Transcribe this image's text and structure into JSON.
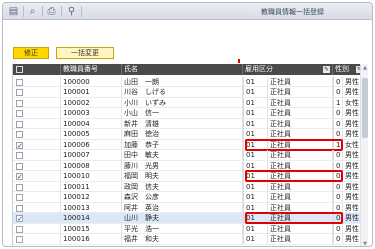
{
  "window": {
    "title": "教職員情報一括登録"
  },
  "toolbar": {
    "icons": [
      "document-list-icon",
      "magnifier-icon",
      "printer-icon",
      "person-key-icon"
    ]
  },
  "actions": {
    "edit_label": "修正",
    "bulk_change_label": "一括変更"
  },
  "table": {
    "columns": {
      "check": "",
      "staff_no": "教職員番号",
      "name": "氏名",
      "employment": "雇用区分",
      "sex": "性別"
    },
    "rows": [
      {
        "checked": false,
        "staff_no": "100000",
        "name": "山田　一朗",
        "emp_code": "01",
        "emp_name": "正社員",
        "sex_code": "0",
        "sex_name": "男性"
      },
      {
        "checked": false,
        "staff_no": "100001",
        "name": "川谷　しげる",
        "emp_code": "01",
        "emp_name": "正社員",
        "sex_code": "0",
        "sex_name": "男性"
      },
      {
        "checked": false,
        "staff_no": "100002",
        "name": "小川　いずみ",
        "emp_code": "01",
        "emp_name": "正社員",
        "sex_code": "1",
        "sex_name": "女性"
      },
      {
        "checked": false,
        "staff_no": "100003",
        "name": "小山　信一",
        "emp_code": "01",
        "emp_name": "正社員",
        "sex_code": "0",
        "sex_name": "男性"
      },
      {
        "checked": false,
        "staff_no": "100004",
        "name": "新井　清雄",
        "emp_code": "01",
        "emp_name": "正社員",
        "sex_code": "0",
        "sex_name": "男性"
      },
      {
        "checked": false,
        "staff_no": "100005",
        "name": "麻田　徳治",
        "emp_code": "01",
        "emp_name": "正社員",
        "sex_code": "0",
        "sex_name": "男性"
      },
      {
        "checked": true,
        "staff_no": "100006",
        "name": "加藤　恭子",
        "emp_code": "01",
        "emp_name": "正社員",
        "sex_code": "1",
        "sex_name": "女性"
      },
      {
        "checked": false,
        "staff_no": "100007",
        "name": "田中　敏夫",
        "emp_code": "01",
        "emp_name": "正社員",
        "sex_code": "0",
        "sex_name": "男性"
      },
      {
        "checked": false,
        "staff_no": "100008",
        "name": "藤川　光男",
        "emp_code": "01",
        "emp_name": "正社員",
        "sex_code": "0",
        "sex_name": "男性"
      },
      {
        "checked": true,
        "staff_no": "100010",
        "name": "福岡　明夫",
        "emp_code": "01",
        "emp_name": "正社員",
        "sex_code": "0",
        "sex_name": "男性"
      },
      {
        "checked": false,
        "staff_no": "100011",
        "name": "政岡　信夫",
        "emp_code": "01",
        "emp_name": "正社員",
        "sex_code": "0",
        "sex_name": "男性"
      },
      {
        "checked": false,
        "staff_no": "100012",
        "name": "森沢　公彦",
        "emp_code": "01",
        "emp_name": "正社員",
        "sex_code": "0",
        "sex_name": "男性"
      },
      {
        "checked": false,
        "staff_no": "100013",
        "name": "阿井　英治",
        "emp_code": "01",
        "emp_name": "正社員",
        "sex_code": "0",
        "sex_name": "男性"
      },
      {
        "checked": true,
        "staff_no": "100014",
        "name": "山川　静夫",
        "emp_code": "01",
        "emp_name": "正社員",
        "sex_code": "0",
        "sex_name": "男性"
      },
      {
        "checked": false,
        "staff_no": "100015",
        "name": "平光　浩一",
        "emp_code": "01",
        "emp_name": "正社員",
        "sex_code": "0",
        "sex_name": "男性"
      },
      {
        "checked": false,
        "staff_no": "100016",
        "name": "福井　和夫",
        "emp_code": "01",
        "emp_name": "正社員",
        "sex_code": "0",
        "sex_name": "男性"
      }
    ],
    "highlighted_row_indexes": [
      6,
      9,
      13
    ],
    "selected_row_index": 13
  },
  "colors": {
    "header_bg": "#4a4a4a",
    "button_primary": "#ffd700",
    "button_secondary": "#fff5bf",
    "highlight": "#e00000",
    "selected_row": "#dbe8f7"
  }
}
